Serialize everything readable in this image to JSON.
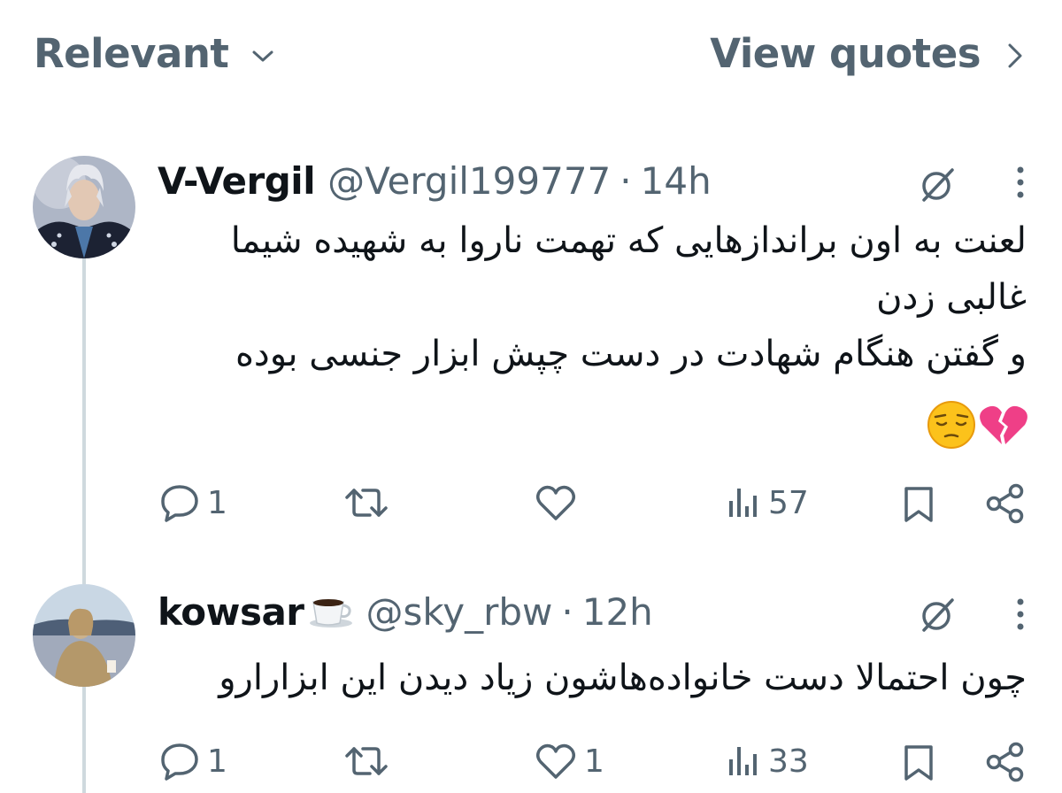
{
  "topbar": {
    "sort_label": "Relevant",
    "quotes_label": "View quotes"
  },
  "tweets": [
    {
      "display_name": "V-Vergil",
      "handle": "@Vergil199777",
      "separator": "·",
      "time": "14h",
      "text_lines": [
        "لعنت به اون براندازهایی که تهمت ناروا به شهیده شیما",
        "غالبی زدن",
        "و گفتن هنگام شهادت در دست چپش ابزار جنسی بوده"
      ],
      "emojis": [
        "pensive-face",
        "broken-heart"
      ],
      "replies": "1",
      "reposts": "",
      "likes": "",
      "views": "57"
    },
    {
      "display_name": "kowsar",
      "name_emoji": "hot-beverage",
      "handle": "@sky_rbw",
      "separator": "·",
      "time": "12h",
      "text_lines": [
        "چون احتمالا دست خانواده‌هاشون زیاد دیدن این ابزارارو"
      ],
      "replies": "1",
      "reposts": "",
      "likes": "1",
      "views": "33"
    }
  ],
  "colors": {
    "text_primary": "#0f1419",
    "text_secondary": "#536471",
    "thread_line": "#cfd9de"
  },
  "icons": [
    "chevron-down-icon",
    "chevron-right-icon",
    "grok-icon",
    "more-icon",
    "reply-icon",
    "repost-icon",
    "like-icon",
    "views-icon",
    "bookmark-icon",
    "share-icon"
  ]
}
